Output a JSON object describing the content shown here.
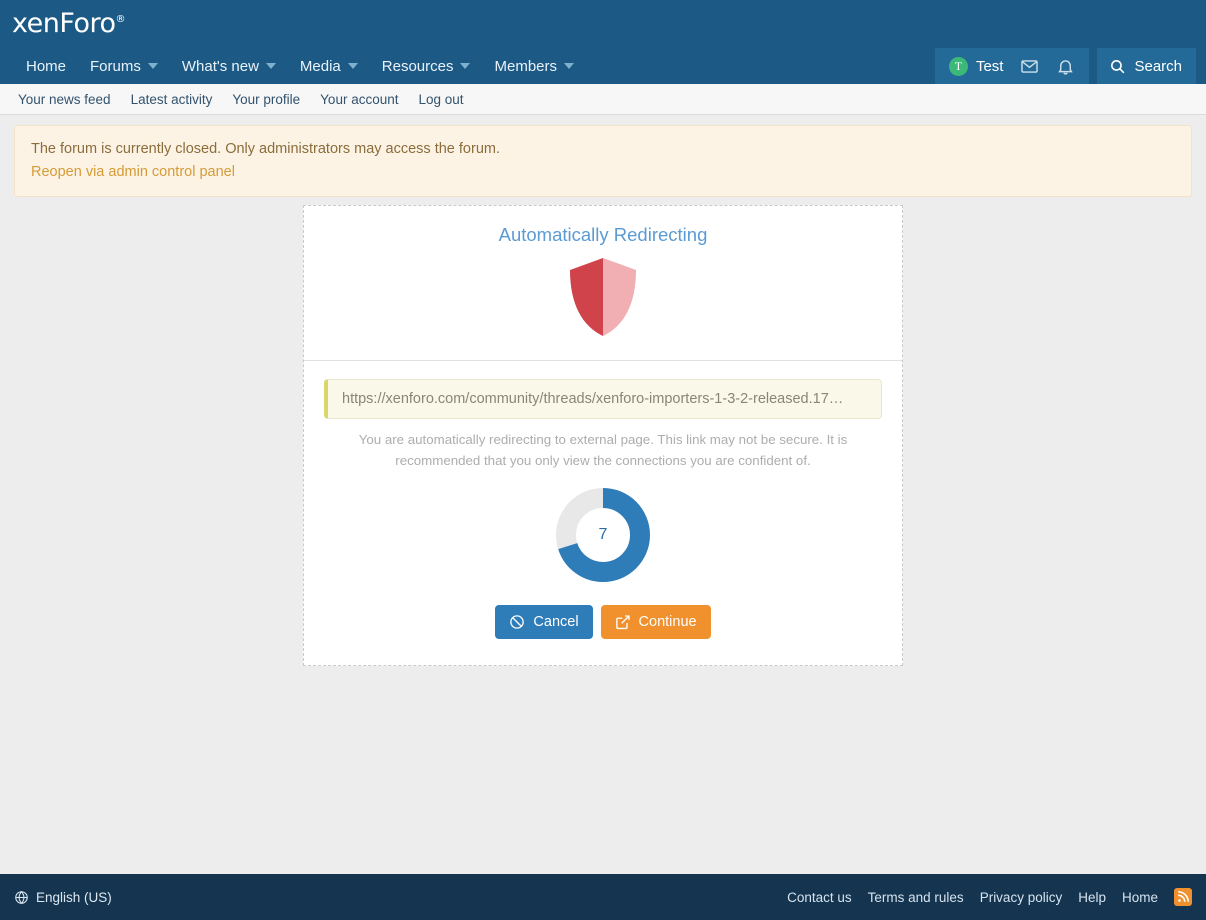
{
  "header": {
    "logo_text": "xenForo",
    "logo_mark": "®",
    "nav": [
      {
        "label": "Home",
        "has_caret": false
      },
      {
        "label": "Forums",
        "has_caret": true
      },
      {
        "label": "What's new",
        "has_caret": true
      },
      {
        "label": "Media",
        "has_caret": true
      },
      {
        "label": "Resources",
        "has_caret": true
      },
      {
        "label": "Members",
        "has_caret": true
      }
    ],
    "account": {
      "avatar_initial": "T",
      "avatar_color": "#3cb878",
      "username": "Test",
      "inbox_icon": "envelope-icon",
      "alerts_icon": "bell-icon"
    },
    "search": {
      "label": "Search",
      "icon": "search-icon"
    },
    "bar_color": "#1c5a85"
  },
  "subnav": {
    "items": [
      {
        "label": "Your news feed"
      },
      {
        "label": "Latest activity"
      },
      {
        "label": "Your profile"
      },
      {
        "label": "Your account"
      },
      {
        "label": "Log out"
      }
    ]
  },
  "notice": {
    "message": "The forum is currently closed. Only administrators may access the forum.",
    "link_label": "Reopen via admin control panel",
    "background": "#fdf3e5",
    "text_color": "#8a6d3b",
    "link_color": "#d59b36"
  },
  "redirect": {
    "title": "Automatically Redirecting",
    "shield_icon": "shield-icon",
    "shield_colors": {
      "left": "#d14249",
      "right": "#f0b0b4"
    },
    "url": "https://xenforo.com/community/threads/xenforo-importers-1-3-2-released.17…",
    "description": "You are automatically redirecting to external page. This link may not be secure. It is recommended that you only view the connections you are confident of.",
    "countdown": {
      "value": "7",
      "progress_percent": 70,
      "ring_color": "#2e7cb8",
      "track_color": "#e8e8e8"
    },
    "buttons": {
      "cancel": {
        "label": "Cancel",
        "icon": "no-entry-icon",
        "color": "#2e7cb8"
      },
      "continue": {
        "label": "Continue",
        "icon": "external-link-icon",
        "color": "#f0912d"
      }
    }
  },
  "footer": {
    "language": {
      "label": "English (US)",
      "icon": "globe-icon"
    },
    "links": [
      {
        "label": "Contact us"
      },
      {
        "label": "Terms and rules"
      },
      {
        "label": "Privacy policy"
      },
      {
        "label": "Help"
      },
      {
        "label": "Home"
      }
    ],
    "rss_icon": "rss-icon",
    "background": "#14344f"
  }
}
